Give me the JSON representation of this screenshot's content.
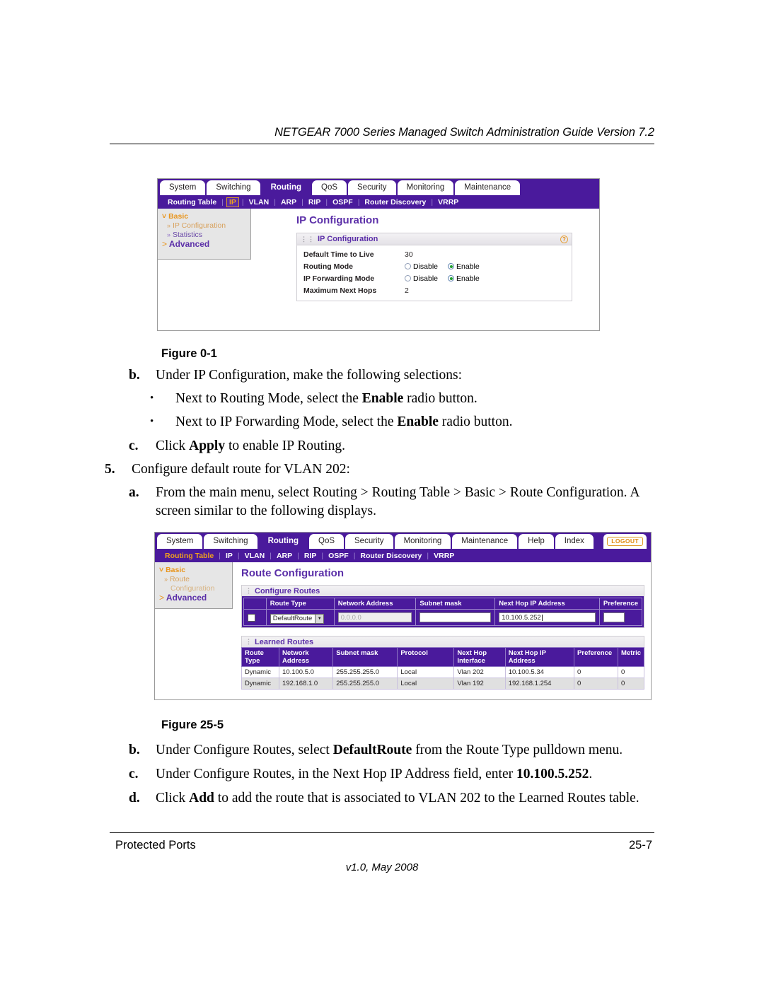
{
  "header": {
    "running_head": "NETGEAR 7000 Series Managed Switch Administration Guide Version 7.2"
  },
  "footer": {
    "left": "Protected Ports",
    "page_number": "25-7",
    "version_line": "v1.0, May 2008"
  },
  "figure1": {
    "caption": "Figure 0-1",
    "tabs": [
      {
        "label": "System",
        "selected": false
      },
      {
        "label": "Switching",
        "selected": false
      },
      {
        "label": "Routing",
        "selected": true
      },
      {
        "label": "QoS",
        "selected": false
      },
      {
        "label": "Security",
        "selected": false
      },
      {
        "label": "Monitoring",
        "selected": false
      },
      {
        "label": "Maintenance",
        "selected": false
      }
    ],
    "subnav": [
      {
        "label": "Routing Table",
        "state": "normal"
      },
      {
        "label": "IP",
        "state": "boxed"
      },
      {
        "label": "VLAN",
        "state": "normal"
      },
      {
        "label": "ARP",
        "state": "normal"
      },
      {
        "label": "RIP",
        "state": "normal"
      },
      {
        "label": "OSPF",
        "state": "normal"
      },
      {
        "label": "Router Discovery",
        "state": "normal"
      },
      {
        "label": "VRRP",
        "state": "normal"
      }
    ],
    "leftnav": [
      {
        "label": "Basic",
        "level": 1
      },
      {
        "label": "IP Configuration",
        "level": 2,
        "current": true
      },
      {
        "label": "Statistics",
        "level": 2,
        "current": false
      },
      {
        "label": "Advanced",
        "level": 1
      }
    ],
    "page_title": "IP Configuration",
    "panel": {
      "title": "IP Configuration",
      "help_icon": "help-question-icon",
      "rows": [
        {
          "label": "Default Time to Live",
          "type": "value",
          "value": "30"
        },
        {
          "label": "Routing Mode",
          "type": "radio",
          "options": [
            {
              "label": "Disable",
              "checked": false
            },
            {
              "label": "Enable",
              "checked": true
            }
          ]
        },
        {
          "label": "IP Forwarding Mode",
          "type": "radio",
          "options": [
            {
              "label": "Disable",
              "checked": false
            },
            {
              "label": "Enable",
              "checked": true
            }
          ]
        },
        {
          "label": "Maximum Next Hops",
          "type": "value",
          "value": "2"
        }
      ]
    }
  },
  "figure2": {
    "caption": "Figure 25-5",
    "tabs": [
      {
        "label": "System",
        "selected": false
      },
      {
        "label": "Switching",
        "selected": false
      },
      {
        "label": "Routing",
        "selected": true
      },
      {
        "label": "QoS",
        "selected": false
      },
      {
        "label": "Security",
        "selected": false
      },
      {
        "label": "Monitoring",
        "selected": false
      },
      {
        "label": "Maintenance",
        "selected": false
      },
      {
        "label": "Help",
        "selected": false
      },
      {
        "label": "Index",
        "selected": false
      }
    ],
    "logout_label": "LOGOUT",
    "subnav": [
      {
        "label": "Routing Table",
        "state": "current"
      },
      {
        "label": "IP",
        "state": "normal"
      },
      {
        "label": "VLAN",
        "state": "normal"
      },
      {
        "label": "ARP",
        "state": "normal"
      },
      {
        "label": "RIP",
        "state": "normal"
      },
      {
        "label": "OSPF",
        "state": "normal"
      },
      {
        "label": "Router Discovery",
        "state": "normal"
      },
      {
        "label": "VRRP",
        "state": "normal"
      }
    ],
    "leftnav": [
      {
        "label": "Basic",
        "level": 1
      },
      {
        "label": "Route",
        "level": 2,
        "current": true
      },
      {
        "label": "Configuration",
        "level": 3,
        "current": true
      },
      {
        "label": "Advanced",
        "level": 1
      }
    ],
    "page_title": "Route Configuration",
    "configure_routes": {
      "title": "Configure Routes",
      "columns": [
        "",
        "Route Type",
        "Network Address",
        "Subnet mask",
        "Next Hop IP Address",
        "Preference"
      ],
      "row": {
        "checkbox_checked": false,
        "route_type_selected": "DefaultRoute",
        "network_address": "0.0.0.0",
        "network_address_disabled": true,
        "subnet_mask": "",
        "next_hop_ip_address": "10.100.5.252",
        "preference": ""
      }
    },
    "learned_routes": {
      "title": "Learned Routes",
      "columns": [
        "Route\nType",
        "Network\nAddress",
        "Subnet mask",
        "Protocol",
        "Next Hop\nInterface",
        "Next Hop IP Address",
        "Preference",
        "Metric"
      ],
      "rows": [
        {
          "route_type": "Dynamic",
          "network_address": "10.100.5.0",
          "subnet_mask": "255.255.255.0",
          "protocol": "Local",
          "next_hop_interface": "Vlan 202",
          "next_hop_ip_address": "10.100.5.34",
          "preference": "0",
          "metric": "0"
        },
        {
          "route_type": "Dynamic",
          "network_address": "192.168.1.0",
          "subnet_mask": "255.255.255.0",
          "protocol": "Local",
          "next_hop_interface": "Vlan 192",
          "next_hop_ip_address": "192.168.1.254",
          "preference": "0",
          "metric": "0"
        }
      ]
    }
  },
  "body": {
    "step_b1_marker": "b.",
    "step_b1_text": "Under IP Configuration, make the following selections:",
    "bullet1_pre": "Next to Routing Mode, select the ",
    "bullet1_bold": "Enable",
    "bullet1_post": " radio button.",
    "bullet2_pre": "Next to IP Forwarding Mode, select the ",
    "bullet2_bold": "Enable",
    "bullet2_post": " radio button.",
    "step_c1_marker": "c.",
    "step_c1_pre": "Click ",
    "step_c1_bold": "Apply",
    "step_c1_post": " to enable IP Routing.",
    "step_5_marker": "5.",
    "step_5_text": "Configure default route for VLAN 202:",
    "step_a2_marker": "a.",
    "step_a2_text": "From the main menu, select Routing > Routing Table > Basic > Route Configuration. A screen similar to the following displays.",
    "step_b2_marker": "b.",
    "step_b2_pre": "Under Configure Routes, select ",
    "step_b2_bold": "DefaultRoute",
    "step_b2_post": " from the Route Type pulldown menu.",
    "step_c2_marker": "c.",
    "step_c2_pre": "Under Configure Routes, in the Next Hop IP Address field, enter ",
    "step_c2_bold": "10.100.5.252",
    "step_c2_post": ".",
    "step_d2_marker": "d.",
    "step_d2_pre": "Click ",
    "step_d2_bold": "Add",
    "step_d2_post": " to add the route that is associated to VLAN 202 to the Learned Routes table.",
    "bullet_glyph": "•"
  }
}
